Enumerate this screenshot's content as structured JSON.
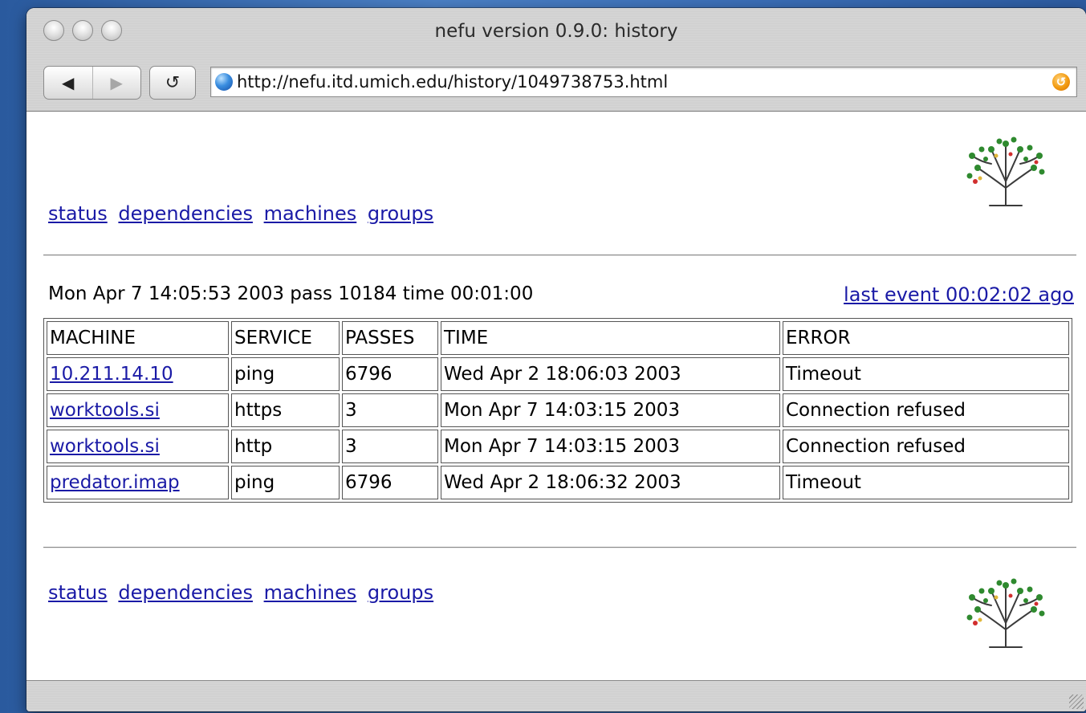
{
  "window": {
    "title": "nefu version 0.9.0: history"
  },
  "toolbar": {
    "back_icon": "◀",
    "forward_icon": "▶",
    "reload_icon": "↺",
    "url": "http://nefu.itd.umich.edu/history/1049738753.html",
    "snapback_icon": "↺"
  },
  "nav_links": [
    "status",
    "dependencies",
    "machines",
    "groups"
  ],
  "summary": "Mon Apr 7 14:05:53 2003 pass 10184 time 00:01:00",
  "last_event": "last event 00:02:02 ago",
  "table": {
    "headers": [
      "MACHINE",
      "SERVICE",
      "PASSES",
      "TIME",
      "ERROR"
    ],
    "rows": [
      {
        "machine": "10.211.14.10",
        "service": "ping",
        "passes": "6796",
        "time": "Wed Apr 2 18:06:03 2003",
        "error": "Timeout"
      },
      {
        "machine": "worktools.si",
        "service": "https",
        "passes": "3",
        "time": "Mon Apr 7 14:03:15 2003",
        "error": "Connection refused"
      },
      {
        "machine": "worktools.si",
        "service": "http",
        "passes": "3",
        "time": "Mon Apr 7 14:03:15 2003",
        "error": "Connection refused"
      },
      {
        "machine": "predator.imap",
        "service": "ping",
        "passes": "6796",
        "time": "Wed Apr 2 18:06:32 2003",
        "error": "Timeout"
      }
    ]
  },
  "colors": {
    "link": "#1a1aa6",
    "desktop": "#3a6db5"
  }
}
